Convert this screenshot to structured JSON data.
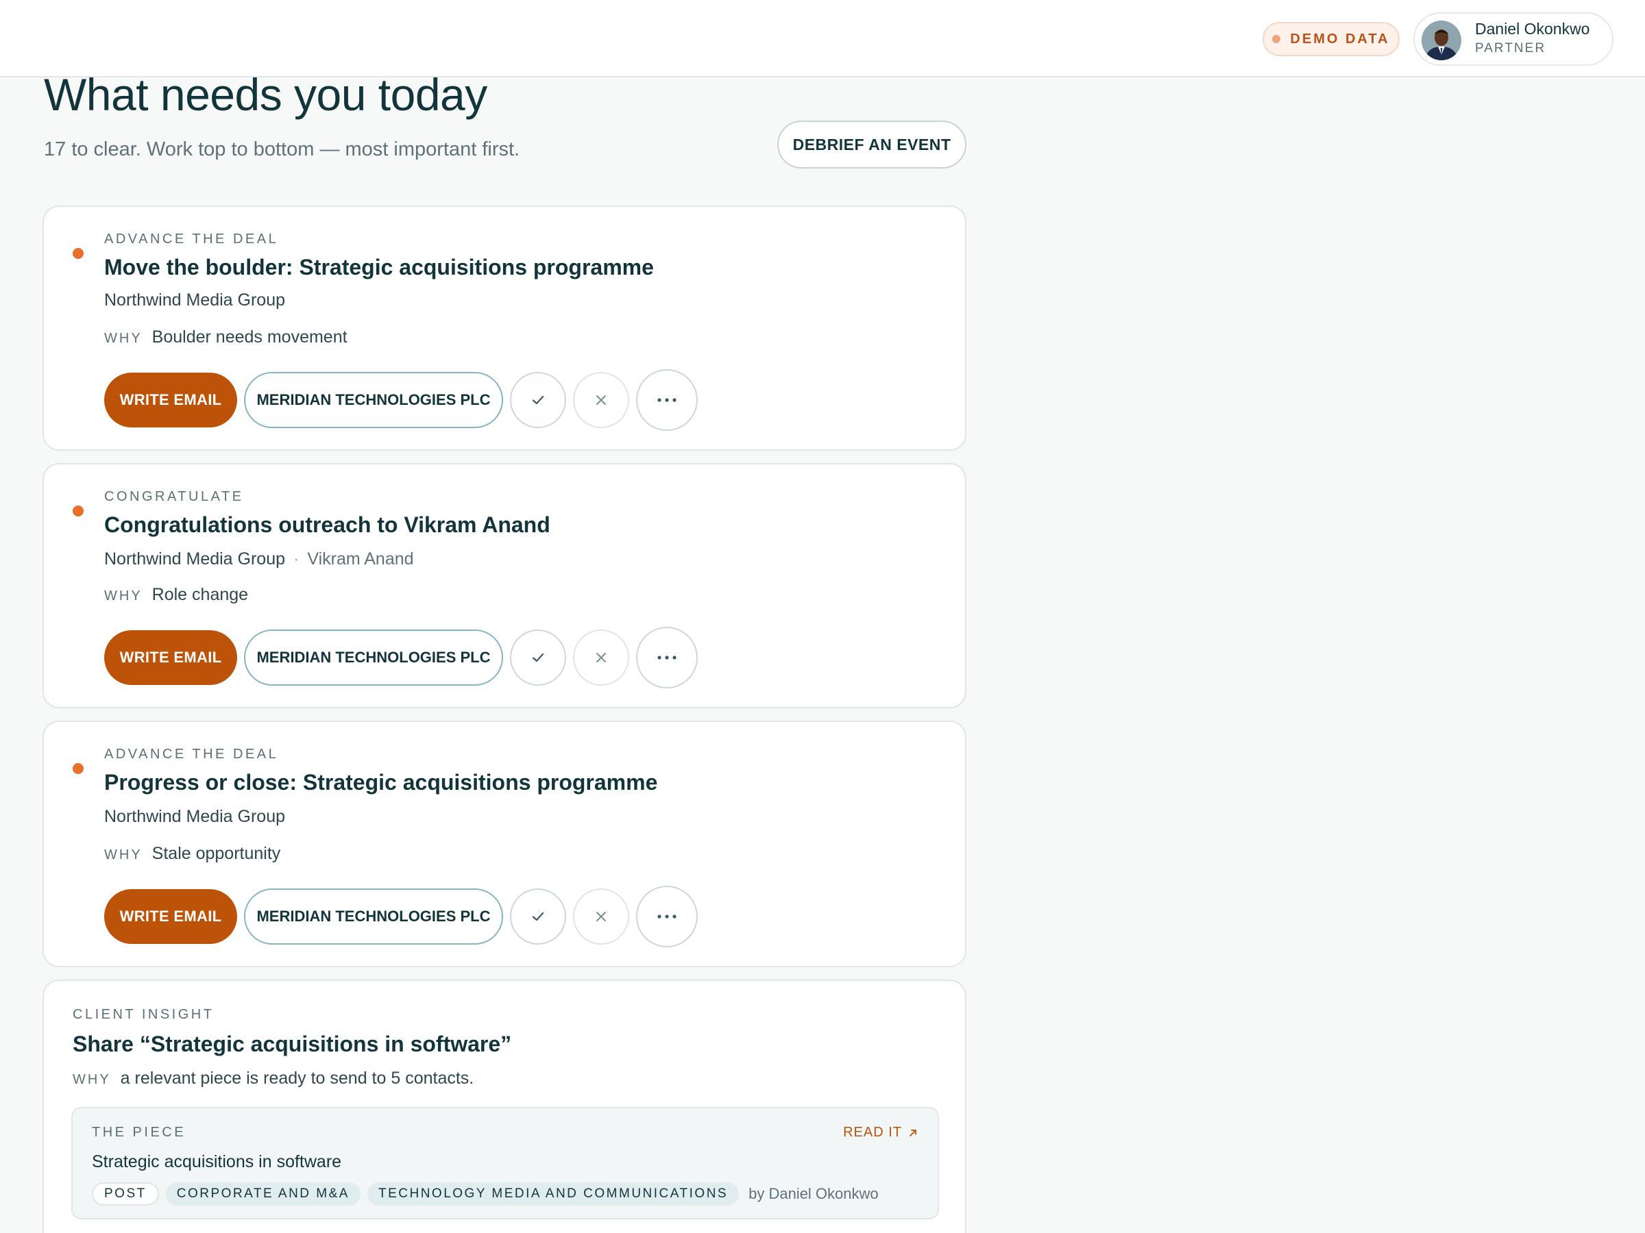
{
  "header": {
    "demo_badge": "DEMO DATA",
    "user": {
      "name": "Daniel Okonkwo",
      "role": "PARTNER"
    }
  },
  "page": {
    "title": "What needs you today",
    "subtitle": "17 to clear. Work top to bottom — most important first.",
    "debrief_button": "DEBRIEF AN EVENT"
  },
  "tasks": [
    {
      "kicker": "ADVANCE THE DEAL",
      "title": "Move the boulder: Strategic acquisitions programme",
      "company": "Northwind Media Group",
      "contact": "",
      "why_label": "WHY",
      "why": "Boulder needs movement",
      "primary_action": "WRITE EMAIL",
      "company_action": "MERIDIAN TECHNOLOGIES PLC"
    },
    {
      "kicker": "CONGRATULATE",
      "title": "Congratulations outreach to Vikram Anand",
      "company": "Northwind Media Group",
      "contact": "Vikram Anand",
      "why_label": "WHY",
      "why": "Role change",
      "primary_action": "WRITE EMAIL",
      "company_action": "MERIDIAN TECHNOLOGIES PLC"
    },
    {
      "kicker": "ADVANCE THE DEAL",
      "title": "Progress or close: Strategic acquisitions programme",
      "company": "Northwind Media Group",
      "contact": "",
      "why_label": "WHY",
      "why": "Stale opportunity",
      "primary_action": "WRITE EMAIL",
      "company_action": "MERIDIAN TECHNOLOGIES PLC"
    }
  ],
  "insight": {
    "kicker": "CLIENT INSIGHT",
    "title": "Share “Strategic acquisitions in software”",
    "why_label": "WHY",
    "why": "a relevant piece is ready to send to 5 contacts.",
    "piece": {
      "kicker": "THE PIECE",
      "read_label": "READ IT",
      "title": "Strategic acquisitions in software",
      "tags": [
        "POST",
        "CORPORATE AND M&A",
        "TECHNOLOGY MEDIA AND COMMUNICATIONS"
      ],
      "byline": "by Daniel Okonkwo"
    }
  },
  "icons": {
    "priority": "dot-icon",
    "done": "check-icon",
    "dismiss": "close-icon",
    "more": "more-icon",
    "external": "arrow-up-right-icon"
  },
  "colors": {
    "accent": "#bd5308",
    "priority_dot": "#e8702a",
    "text_primary": "#12343b"
  }
}
